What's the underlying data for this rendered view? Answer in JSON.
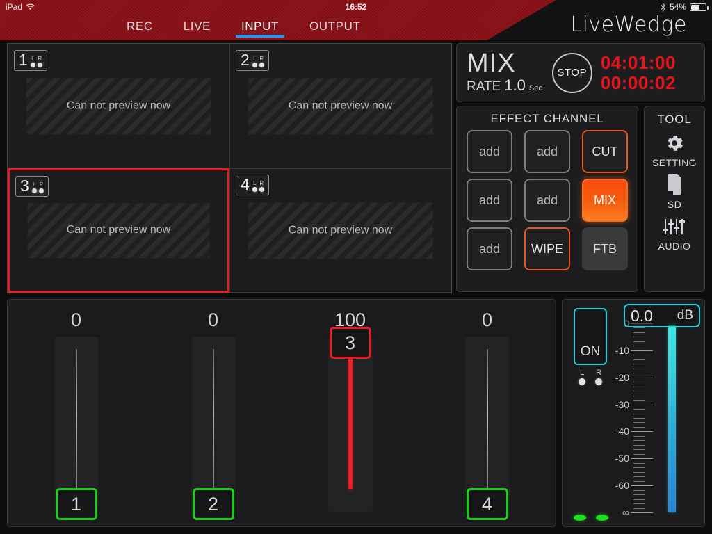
{
  "status_bar": {
    "device": "iPad",
    "wifi_icon": "wifi-icon",
    "time": "16:52",
    "bluetooth_icon": "bluetooth-icon",
    "battery_percent": "54%",
    "battery_level": 54
  },
  "header": {
    "logo": "LiveWedge",
    "tabs": [
      {
        "label": "REC",
        "active": false
      },
      {
        "label": "LIVE",
        "active": false
      },
      {
        "label": "INPUT",
        "active": true
      },
      {
        "label": "OUTPUT",
        "active": false
      }
    ]
  },
  "previews": [
    {
      "number": "1",
      "left_label": "L",
      "right_label": "R",
      "message": "Can not preview now",
      "selected": false
    },
    {
      "number": "2",
      "left_label": "L",
      "right_label": "R",
      "message": "Can not preview now",
      "selected": false
    },
    {
      "number": "3",
      "left_label": "L",
      "right_label": "R",
      "message": "Can not preview now",
      "selected": true
    },
    {
      "number": "4",
      "left_label": "L",
      "right_label": "R",
      "message": "Can not preview now",
      "selected": false
    }
  ],
  "mix_panel": {
    "title": "MIX",
    "rate_label": "RATE",
    "rate_value": "1.0",
    "rate_unit": "Sec",
    "stop_label": "STOP",
    "timer_primary": "04:01:00",
    "timer_secondary": "00:00:02",
    "timer_color": "#e8121b"
  },
  "effect_channel": {
    "title": "EFFECT CHANNEL",
    "buttons": [
      {
        "label": "add",
        "style": "add"
      },
      {
        "label": "add",
        "style": "add"
      },
      {
        "label": "CUT",
        "style": "outline-red"
      },
      {
        "label": "add",
        "style": "add"
      },
      {
        "label": "add",
        "style": "add"
      },
      {
        "label": "MIX",
        "style": "filled-red"
      },
      {
        "label": "add",
        "style": "add"
      },
      {
        "label": "WIPE",
        "style": "outline-red"
      },
      {
        "label": "FTB",
        "style": "ftb"
      }
    ],
    "active_color": "#ff4b10"
  },
  "tool_panel": {
    "title": "TOOL",
    "items": [
      {
        "label": "SETTING",
        "icon": "gear-icon"
      },
      {
        "label": "SD",
        "icon": "sd-card-icon"
      },
      {
        "label": "AUDIO",
        "icon": "audio-sliders-icon"
      }
    ]
  },
  "faders": [
    {
      "value": "0",
      "handle_label": "1",
      "handle_color": "#17cf17",
      "position_percent": 0
    },
    {
      "value": "0",
      "handle_label": "2",
      "handle_color": "#17cf17",
      "position_percent": 0
    },
    {
      "value": "100",
      "handle_label": "3",
      "handle_color": "#e81c24",
      "position_percent": 100
    },
    {
      "value": "0",
      "handle_label": "4",
      "handle_color": "#17cf17",
      "position_percent": 0
    }
  ],
  "meter_panel": {
    "on_label": "ON",
    "on_active_color": "#20d0dd",
    "left_label": "L",
    "right_label": "R",
    "db_value": "0.0",
    "db_unit": "dB",
    "meter_level_percent": 100,
    "scale_ticks": [
      "0",
      "-10",
      "-20",
      "-30",
      "-40",
      "-50",
      "-60",
      "∞"
    ],
    "led_count": 2,
    "led_color": "#1fdd1f"
  }
}
